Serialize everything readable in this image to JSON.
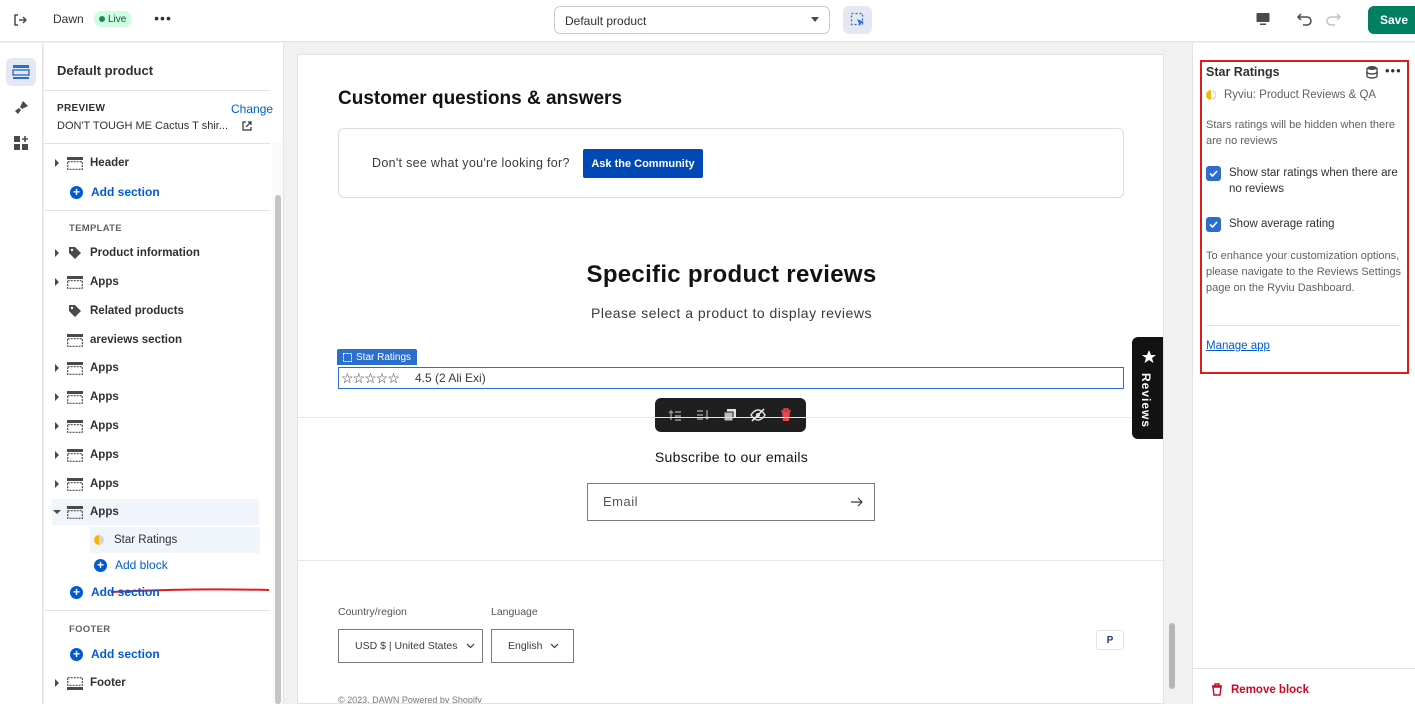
{
  "topbar": {
    "theme_name": "Dawn",
    "live_badge": "Live",
    "more_label": "•••",
    "template_select": "Default product",
    "save_label": "Save"
  },
  "sidebar": {
    "title": "Default product",
    "preview_label": "PREVIEW",
    "change_label": "Change",
    "preview_product": "DON'T TOUGH ME Cactus T shir...",
    "header_item": "Header",
    "add_section": "Add section",
    "template_label": "TEMPLATE",
    "template_items": [
      {
        "label": "Product information",
        "icon": "tag-icon"
      },
      {
        "label": "Apps",
        "icon": "section-icon"
      },
      {
        "label": "Related products",
        "icon": "tag-icon"
      },
      {
        "label": "areviews section",
        "icon": "section-icon"
      },
      {
        "label": "Apps",
        "icon": "section-icon"
      },
      {
        "label": "Apps",
        "icon": "section-icon"
      },
      {
        "label": "Apps",
        "icon": "section-icon"
      },
      {
        "label": "Apps",
        "icon": "section-icon"
      },
      {
        "label": "Apps",
        "icon": "section-icon"
      },
      {
        "label": "Apps",
        "icon": "section-icon"
      }
    ],
    "child_block": "Star Ratings",
    "add_block": "Add block",
    "footer_label": "FOOTER",
    "footer_item": "Footer"
  },
  "canvas": {
    "qa_heading": "Customer questions & answers",
    "qa_text": "Don't see what you're looking for?",
    "qa_button": "Ask the Community",
    "reviews_heading": "Specific product reviews",
    "reviews_sub": "Please select a product to display reviews",
    "block_tag": "Star Ratings",
    "stars": "☆☆☆☆☆",
    "rating_text": "4.5 (2 Ali Exi)",
    "subscribe_heading": "Subscribe to our emails",
    "email_placeholder": "Email",
    "country_label": "Country/region",
    "country_value": "USD $ | United States",
    "language_label": "Language",
    "language_value": "English",
    "payment_badge": "P",
    "reviews_tab": "Reviews",
    "copyright": "© 2023, DAWN Powered by Shopify"
  },
  "panel": {
    "title": "Star Ratings",
    "more_label": "•••",
    "app_name": "Ryviu: Product Reviews & QA",
    "hint_hidden": "Stars ratings will be hidden when there are no reviews",
    "check_no_reviews": "Show star ratings when there are no reviews",
    "check_no_reviews_checked": true,
    "check_average": "Show average rating",
    "check_average_checked": true,
    "hint_enhance": "To enhance your customization options, please navigate to the Reviews Settings page on the Ryviu Dashboard.",
    "manage_app": "Manage app",
    "remove_block": "Remove block"
  },
  "colors": {
    "accent": "#005bd3",
    "save": "#008060",
    "highlight": "#e01b1b",
    "danger": "#c70a24"
  }
}
